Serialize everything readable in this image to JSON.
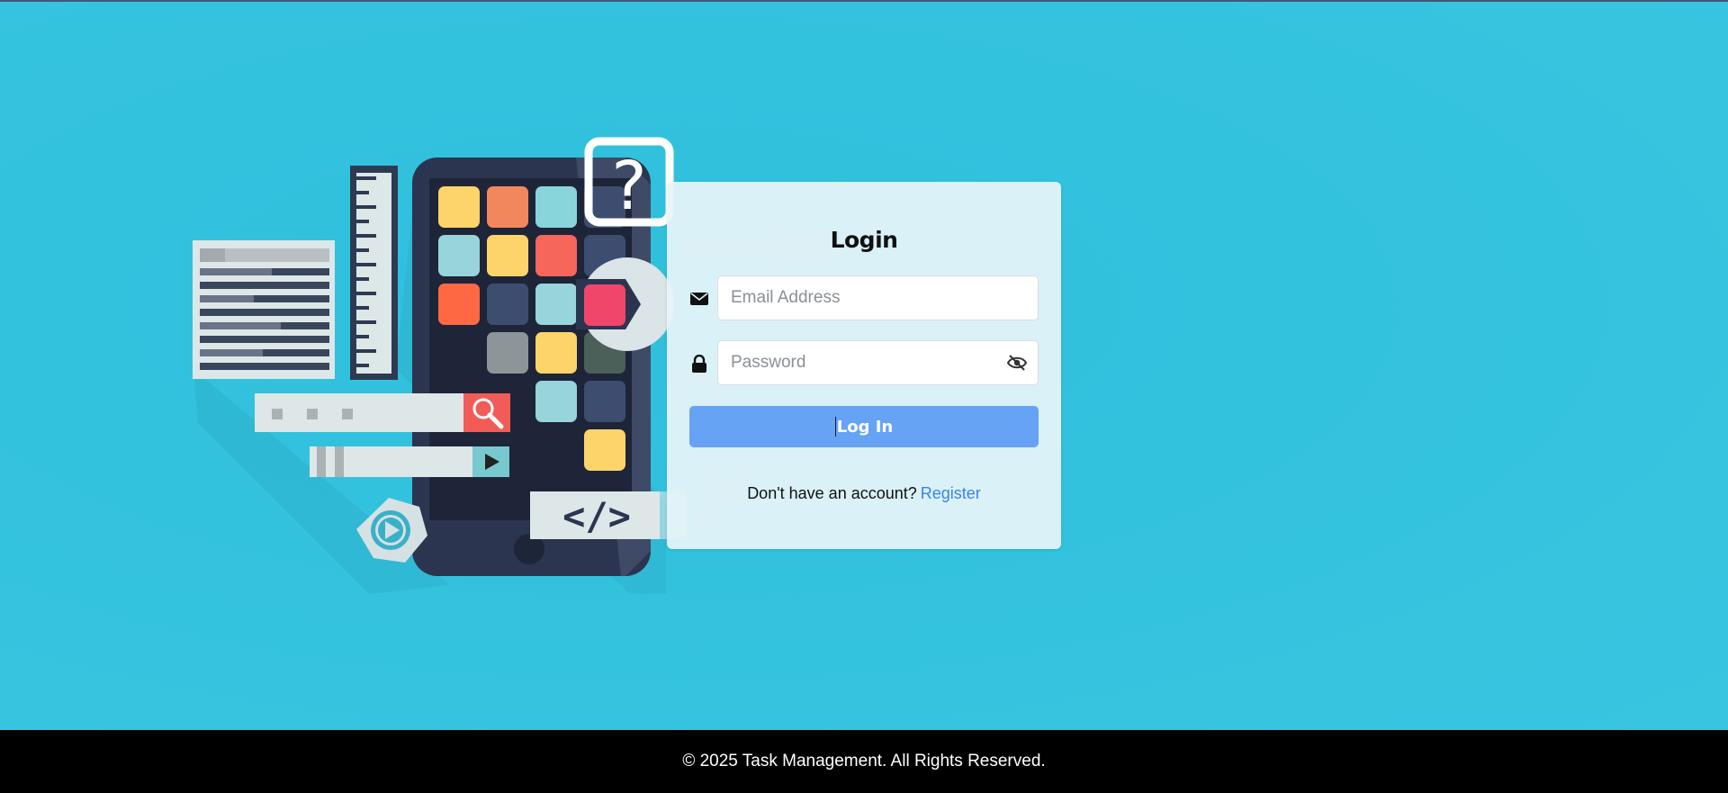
{
  "login": {
    "title": "Login",
    "email_placeholder": "Email Address",
    "password_placeholder": "Password",
    "submit_label": "Log In",
    "register_prompt": "Don't have an account?",
    "register_link": "Register"
  },
  "illustration": {
    "code_tag": "</>",
    "question_mark": "?"
  },
  "footer": {
    "copyright": "© 2025 Task Management. All Rights Reserved."
  },
  "colors": {
    "background": "#36c3df",
    "card": "#e7f4f9",
    "button": "#66a3f5",
    "link": "#3b82e6",
    "footer": "#000000"
  },
  "icons": {
    "email": "envelope-icon",
    "password": "lock-icon",
    "toggle_password": "eye-slash-icon"
  }
}
